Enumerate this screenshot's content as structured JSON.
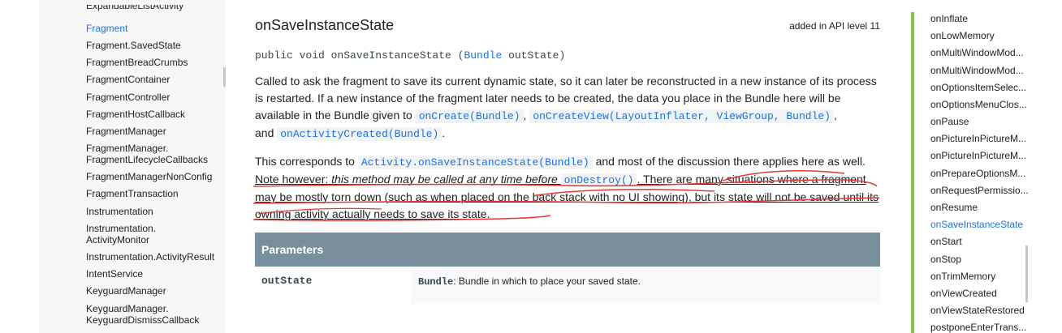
{
  "left_nav": {
    "items": [
      {
        "label": "ExpandableListActivity",
        "active": false
      },
      {
        "label": "Fragment",
        "active": true
      },
      {
        "label": "Fragment.SavedState",
        "active": false
      },
      {
        "label": "FragmentBreadCrumbs",
        "active": false
      },
      {
        "label": "FragmentContainer",
        "active": false
      },
      {
        "label": "FragmentController",
        "active": false
      },
      {
        "label": "FragmentHostCallback",
        "active": false
      },
      {
        "label": "FragmentManager",
        "active": false
      },
      {
        "label": "FragmentManager.",
        "label2": "FragmentLifecycleCallbacks",
        "active": false
      },
      {
        "label": "FragmentManagerNonConfig",
        "active": false
      },
      {
        "label": "FragmentTransaction",
        "active": false
      },
      {
        "label": "Instrumentation",
        "active": false
      },
      {
        "label": "Instrumentation.",
        "label2": "ActivityMonitor",
        "active": false
      },
      {
        "label": "Instrumentation.ActivityResult",
        "active": false
      },
      {
        "label": "IntentService",
        "active": false
      },
      {
        "label": "KeyguardManager",
        "active": false
      },
      {
        "label": "KeyguardManager.",
        "label2": "KeyguardDismissCallback",
        "active": false
      }
    ]
  },
  "method": {
    "title": "onSaveInstanceState",
    "api_level": "added in API level 11",
    "signature": {
      "prefix": "public void onSaveInstanceState (",
      "param_type": "Bundle",
      "suffix": " outState)"
    }
  },
  "description": {
    "p1_text1": "Called to ask the fragment to save its current dynamic state, so it can later be reconstructed in a new instance of its process is restarted. If a new instance of the fragment later needs to be created, the data you place in the Bundle here will be available in the Bundle given to ",
    "p1_link1": "onCreate(Bundle)",
    "p1_sep1": ", ",
    "p1_link2": "onCreateView(LayoutInflater, ViewGroup, Bundle)",
    "p1_sep2": ",",
    "p1_and": "and ",
    "p1_link3": "onActivityCreated(Bundle)",
    "p1_end": ".",
    "p2_text1": "This corresponds to ",
    "p2_link1": "Activity.onSaveInstanceState(Bundle)",
    "p2_text2": " and most of the discussion there applies here as well.",
    "p2_note": "Note however: ",
    "p2_italic": "this method may be called at any time before ",
    "p2_link2": "onDestroy()",
    "p2_text3": ". There are many situations where a fragment may be mostly torn down (such as when placed on the back stack with no UI showing), but its state will not be saved until its owning activity actually needs to save its state."
  },
  "parameters": {
    "header": "Parameters",
    "rows": [
      {
        "name": "outState",
        "type": "Bundle",
        "desc": ": Bundle in which to place your saved state."
      }
    ]
  },
  "toc": {
    "items": [
      {
        "label": "onInflate",
        "active": false
      },
      {
        "label": "onLowMemory",
        "active": false
      },
      {
        "label": "onMultiWindowMod...",
        "active": false
      },
      {
        "label": "onMultiWindowMod...",
        "active": false
      },
      {
        "label": "onOptionsItemSelec...",
        "active": false
      },
      {
        "label": "onOptionsMenuClos...",
        "active": false
      },
      {
        "label": "onPause",
        "active": false
      },
      {
        "label": "onPictureInPictureM...",
        "active": false
      },
      {
        "label": "onPictureInPictureM...",
        "active": false
      },
      {
        "label": "onPrepareOptionsM...",
        "active": false
      },
      {
        "label": "onRequestPermissio...",
        "active": false
      },
      {
        "label": "onResume",
        "active": false
      },
      {
        "label": "onSaveInstanceState",
        "active": true
      },
      {
        "label": "onStart",
        "active": false
      },
      {
        "label": "onStop",
        "active": false
      },
      {
        "label": "onTrimMemory",
        "active": false
      },
      {
        "label": "onViewCreated",
        "active": false
      },
      {
        "label": "onViewStateRestored",
        "active": false
      },
      {
        "label": "postponeEnterTrans...",
        "active": false
      }
    ]
  },
  "colors": {
    "link": "#1a73e8",
    "annotation": "#e53935",
    "toc_bar": "#8bc34a",
    "params_header": "#78909c"
  }
}
